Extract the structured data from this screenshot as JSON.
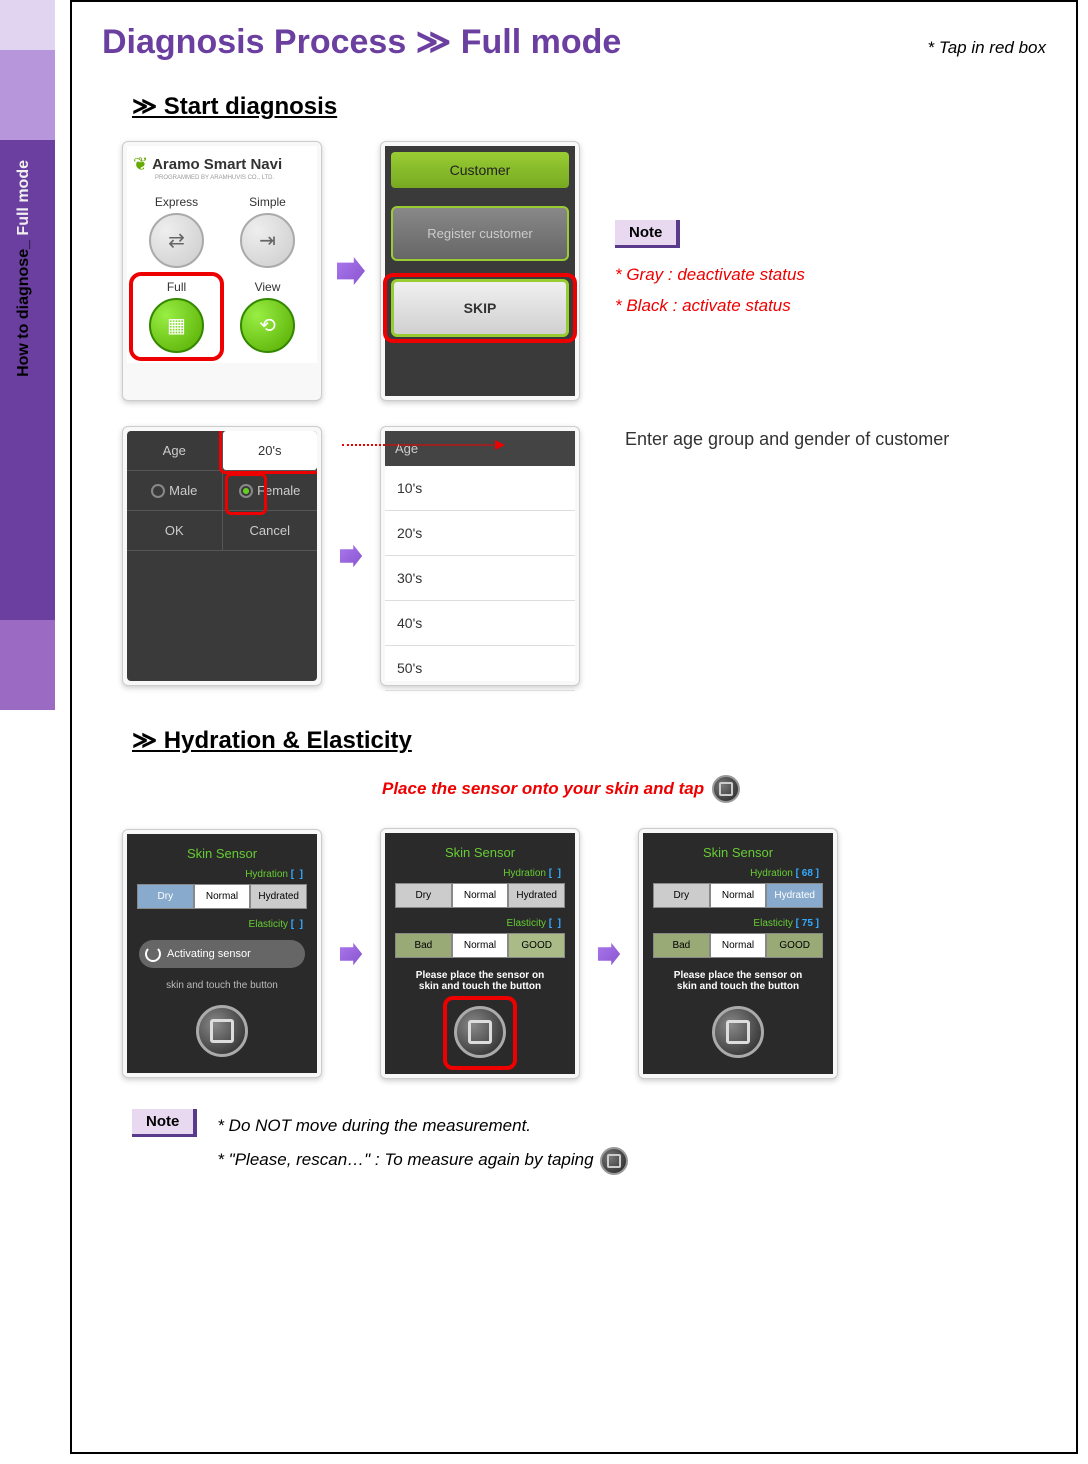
{
  "sidebar": {
    "part1": "How to diagnose_ ",
    "part2": "Full mode"
  },
  "header": {
    "title": "Diagnosis Process ≫ Full mode",
    "hint": "* Tap in red box"
  },
  "section1": {
    "title": "≫ Start diagnosis"
  },
  "s1": {
    "title": "Aramo Smart Navi",
    "sub": "PROGRAMMED BY ARAMHUVIS CO., LTD.",
    "express": "Express",
    "simple": "Simple",
    "full": "Full",
    "view": "View"
  },
  "s2": {
    "customer": "Customer",
    "register": "Register customer",
    "skip": "SKIP"
  },
  "note1": {
    "label": "Note",
    "line1": "* Gray : deactivate status",
    "line2": "* Black : activate status"
  },
  "s3": {
    "age_label": "Age",
    "age_val": "20's",
    "male": "Male",
    "female": "Female",
    "ok": "OK",
    "cancel": "Cancel"
  },
  "s4": {
    "head": "Age",
    "items": [
      "10's",
      "20's",
      "30's",
      "40's",
      "50's"
    ]
  },
  "enter_text": "Enter age group and gender of customer",
  "section2": {
    "title": "≫ Hydration & Elasticity"
  },
  "place_text": "Place the sensor onto your skin and tap",
  "sensor": {
    "title": "Skin Sensor",
    "hydration": "Hydration",
    "elasticity": "Elasticity",
    "dry": "Dry",
    "normal": "Normal",
    "hydrated": "Hydrated",
    "bad": "Bad",
    "good": "GOOD",
    "activating": "Activating sensor",
    "skin_touch": "skin and touch the button",
    "please_place1": "Please place the sensor on",
    "please_place2": "skin and touch the button",
    "please_place2b": "skin and touch the button",
    "val_h": "68",
    "val_e": "75"
  },
  "note2": {
    "label": "Note",
    "line1": "* Do NOT move during the measurement.",
    "line2": "* \"Please, rescan…\" : To measure again by taping"
  }
}
